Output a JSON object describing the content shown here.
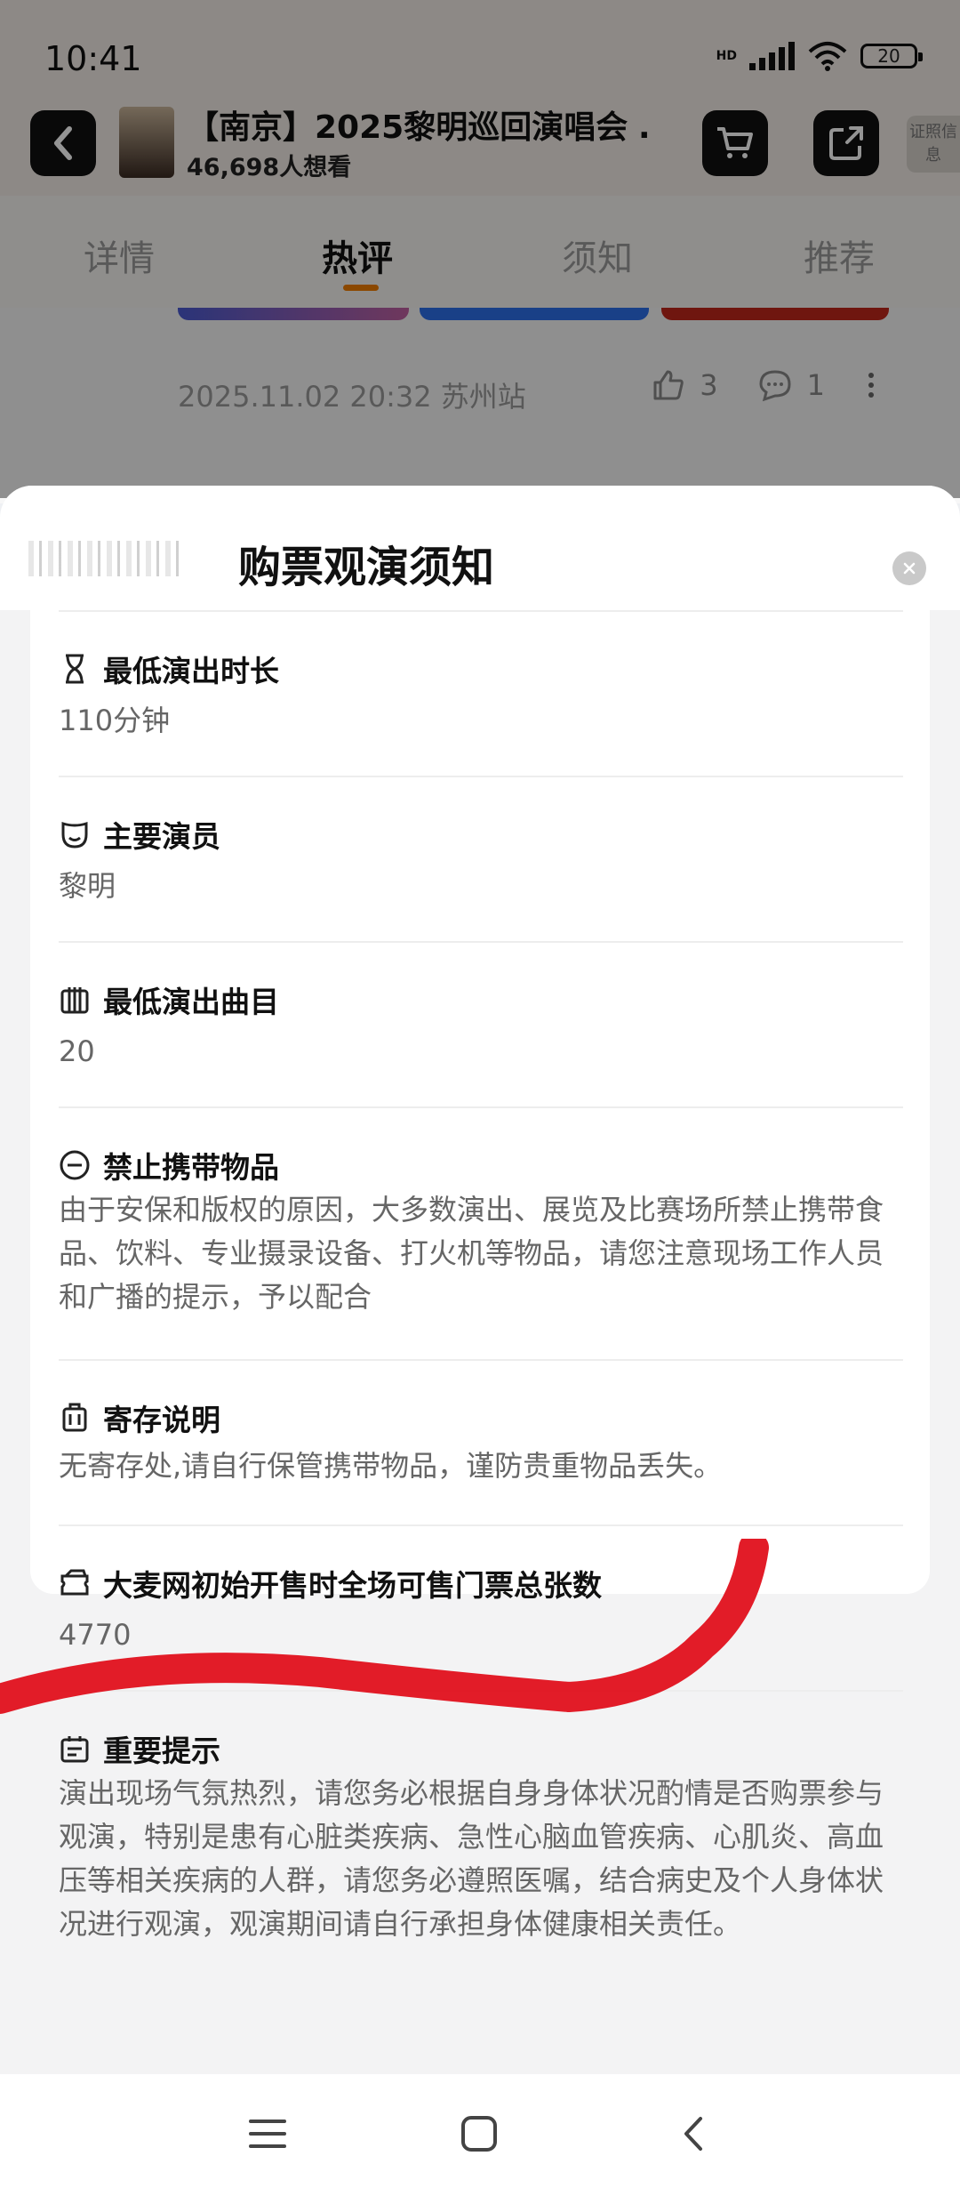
{
  "status_bar": {
    "time": "10:41",
    "network_label": "HD",
    "battery": "20"
  },
  "header": {
    "title": "【南京】2025黎明巡回演唱会 …",
    "subtitle": "46,698人想看",
    "cert_label": "证照信息"
  },
  "tabs": [
    {
      "label": "详情"
    },
    {
      "label": "热评"
    },
    {
      "label": "须知"
    },
    {
      "label": "推荐"
    }
  ],
  "comment": {
    "meta": "2025.11.02 20:32 苏州站",
    "likes": "3",
    "replies": "1"
  },
  "sheet": {
    "title": "购票观演须知",
    "sections": [
      {
        "icon": "hourglass-icon",
        "title": "最低演出时长",
        "body": "110分钟"
      },
      {
        "icon": "mask-icon",
        "title": "主要演员",
        "body": "黎明"
      },
      {
        "icon": "music-sheet-icon",
        "title": "最低演出曲目",
        "body": "20"
      },
      {
        "icon": "prohibited-icon",
        "title": "禁止携带物品",
        "body": "由于安保和版权的原因，大多数演出、展览及比赛场所禁止携带食品、饮料、专业摄录设备、打火机等物品，请您注意现场工作人员和广播的提示，予以配合"
      },
      {
        "icon": "luggage-icon",
        "title": "寄存说明",
        "body": "无寄存处,请自行保管携带物品，谨防贵重物品丢失。"
      },
      {
        "icon": "ticket-icon",
        "title": "大麦网初始开售时全场可售门票总张数",
        "body": "4770"
      },
      {
        "icon": "notice-icon",
        "title": "重要提示",
        "body": "演出现场气氛热烈，请您务必根据自身身体状况酌情是否购票参与观演，特别是患有心脏类疾病、急性心脑血管疾病、心肌炎、高血压等相关疾病的人群，请您务必遵照医嘱，结合病史及个人身体状况进行观演，观演期间请自行承担身体健康相关责任。"
      }
    ]
  },
  "colors": {
    "accent": "#f07d00",
    "marker": "#e0101c"
  }
}
